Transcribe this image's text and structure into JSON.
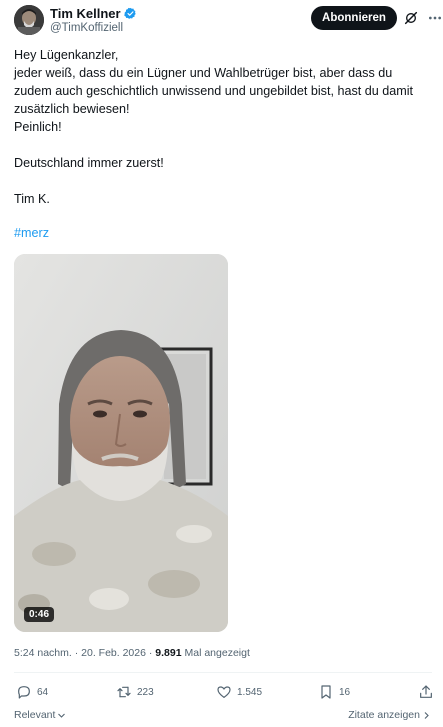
{
  "author": {
    "name": "Tim Kellner",
    "handle": "@TimKoffiziell",
    "verified_color": "#1d9bf0"
  },
  "header": {
    "follow_label": "Abonnieren",
    "grok_icon": "grok-icon",
    "more_icon": "more-icon"
  },
  "tweet": {
    "lines": [
      "Hey Lügenkanzler,",
      "jeder weiß, dass du ein Lügner und Wahlbetrüger bist, aber dass du",
      "zudem auch geschichtlich unwissend und ungebildet bist, hast du damit",
      "zusätzlich bewiesen!",
      "Peinlich!",
      "",
      "Deutschland immer zuerst!",
      "",
      "Tim K."
    ],
    "hashtag": "#merz",
    "hashtag_color": "#1d9bf0"
  },
  "video": {
    "duration": "0:46"
  },
  "meta": {
    "time": "5:24 nachm.",
    "separator": "·",
    "date": "20. Feb. 2026",
    "views": "9.891",
    "views_label": "Mal angezeigt"
  },
  "actions": {
    "replies": "64",
    "reposts": "223",
    "likes": "1.545",
    "bookmarks": "16"
  },
  "footer": {
    "sort_label": "Relevant",
    "quotes_label": "Zitate anzeigen"
  }
}
